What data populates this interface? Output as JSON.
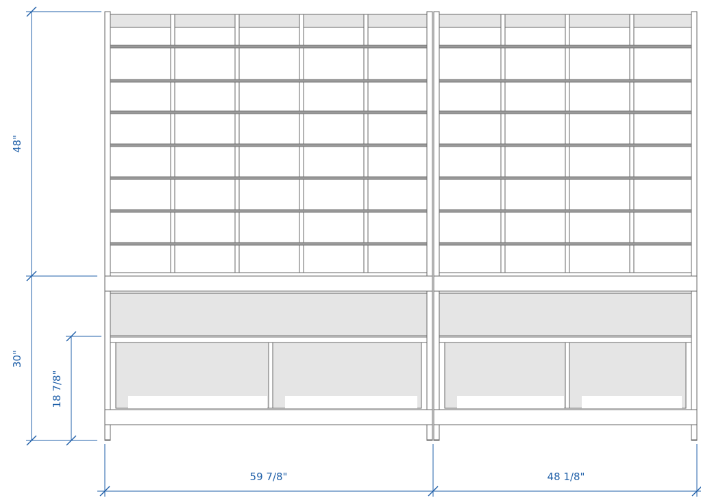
{
  "dimensions": {
    "upper_height": "48\"",
    "lower_height": "30\"",
    "drawer_height": "18 7/8\"",
    "left_width": "59 7/8\"",
    "right_width": "48 1/8\""
  },
  "units": {
    "left": {
      "columns": 5,
      "rows": 8
    },
    "right": {
      "columns": 4,
      "rows": 8
    }
  },
  "colors": {
    "line": "#666666",
    "shade": "#e5e5e5",
    "dimension": "#1f5fa8",
    "background": "#ffffff"
  }
}
